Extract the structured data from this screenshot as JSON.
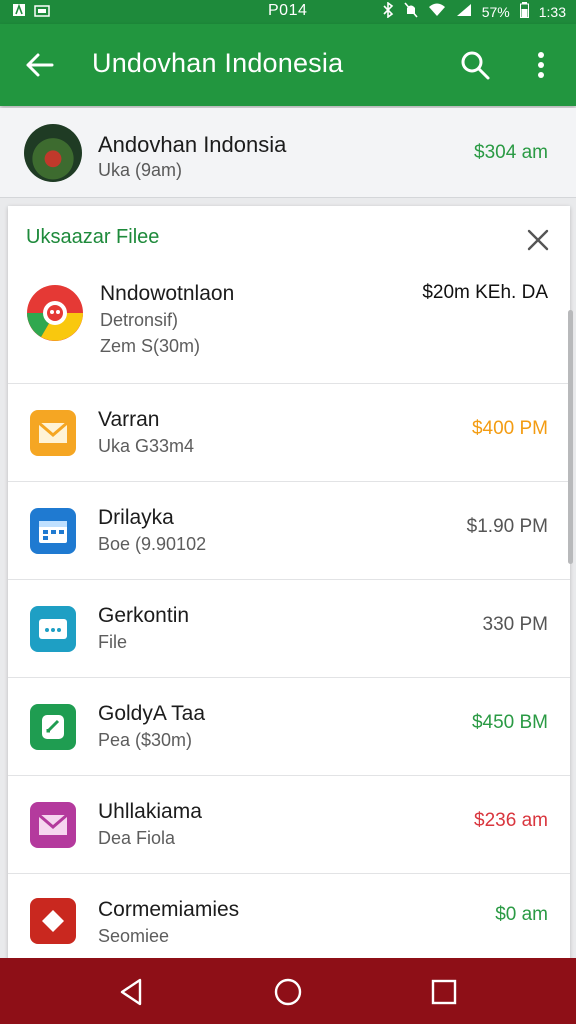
{
  "status_bar": {
    "time": "P014",
    "battery": "57%",
    "clock_right": "1:33"
  },
  "app_bar": {
    "title": "Undovhan Indonesia"
  },
  "header": {
    "name": "Andovhan Indonsia",
    "subtitle": "Uka (9am)",
    "amount": "$304 am"
  },
  "panel": {
    "title": "Uksaazar Filee",
    "rows": [
      {
        "name": "Nndowotnlaon",
        "sub": "Detronsif)",
        "sub2": "Zem S(30m)",
        "amount": "$20m KEh. DA",
        "amount_color": "#111111",
        "icon": "google-chrome-icon",
        "icon_bg": "multi"
      },
      {
        "name": "Varran",
        "sub": "Uka G33m4",
        "amount": "$400 PM",
        "amount_color": "#f39c12",
        "icon": "mail-icon",
        "icon_bg": "#f5a623"
      },
      {
        "name": "Drilayka",
        "sub": "Boe (9.90102",
        "amount": "$1.90 PM",
        "amount_color": "#555555",
        "icon": "calendar-icon",
        "icon_bg": "#1f7ad1"
      },
      {
        "name": "Gerkontin",
        "sub": "File",
        "amount": "330 PM",
        "amount_color": "#555555",
        "icon": "message-icon",
        "icon_bg": "#1e9fc4"
      },
      {
        "name": "GoldyA Taa",
        "sub": "Pea ($30m)",
        "amount": "$450 BM",
        "amount_color": "#2a9a44",
        "icon": "note-icon",
        "icon_bg": "#1f9d51"
      },
      {
        "name": "Uhllakiama",
        "sub": "Dea Fiola",
        "amount": "$236 am",
        "amount_color": "#d9363e",
        "icon": "envelope-icon",
        "icon_bg": "#b43a9d"
      },
      {
        "name": "Cormemiamies",
        "sub": "Seomiee",
        "amount": "$0 am",
        "amount_color": "#2a9a44",
        "icon": "diamond-icon",
        "icon_bg": "#c9281f"
      }
    ]
  }
}
